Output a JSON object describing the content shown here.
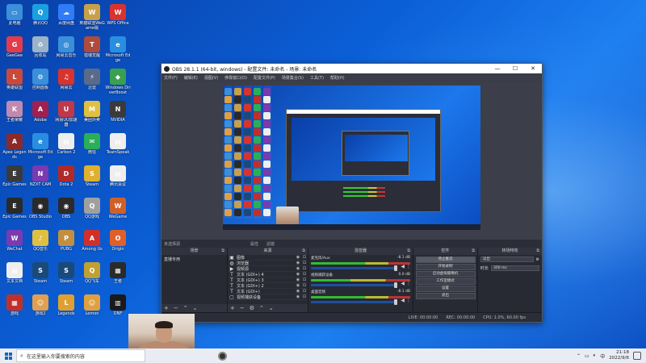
{
  "desktop_icons": [
    {
      "label": "此电脑",
      "color": "#3a8fd8",
      "glyph": "▭"
    },
    {
      "label": "腾讯QQ",
      "color": "#1aa0e0",
      "glyph": "Q"
    },
    {
      "label": "百度网盘",
      "color": "#2f7cf6",
      "glyph": "☁"
    },
    {
      "label": "英雄联盟WeGame版",
      "color": "#c9a04a",
      "glyph": "W"
    },
    {
      "label": "WPS Office",
      "color": "#d9332f",
      "glyph": "W"
    },
    {
      "label": "GeeGee",
      "color": "#e23c4a",
      "glyph": "G"
    },
    {
      "label": "回收站",
      "color": "#9ab3c9",
      "glyph": "♻"
    },
    {
      "label": "网易云音乐",
      "color": "#3a8fd8",
      "glyph": "◎"
    },
    {
      "label": "猎魂觉醒",
      "color": "#b04a3a",
      "glyph": "T"
    },
    {
      "label": "Microsoft Edge",
      "color": "#2a8ee0",
      "glyph": "e"
    },
    {
      "label": "英雄联盟",
      "color": "#c94a3a",
      "glyph": "L"
    },
    {
      "label": "控制面板",
      "color": "#3a8fd8",
      "glyph": "⚙"
    },
    {
      "label": "网易云",
      "color": "#d9332f",
      "glyph": "♫"
    },
    {
      "label": "迅雷",
      "color": "#5a6a8a",
      "glyph": "⚡"
    },
    {
      "label": "Windows DriverBoost",
      "color": "#3aa050",
      "glyph": "◆"
    },
    {
      "label": "王者荣耀",
      "color": "#c08ab0",
      "glyph": "K"
    },
    {
      "label": "Adobe",
      "color": "#a02050",
      "glyph": "A"
    },
    {
      "label": "网易UU加速器",
      "color": "#c0384a",
      "glyph": "U"
    },
    {
      "label": "美团外卖",
      "color": "#e0c040",
      "glyph": "M"
    },
    {
      "label": "NVIDIA",
      "color": "#3a3a3a",
      "glyph": "N"
    },
    {
      "label": "Apex Legends",
      "color": "#8a2a2a",
      "glyph": "A"
    },
    {
      "label": "Microsoft Edge",
      "color": "#2a8ee0",
      "glyph": "e"
    },
    {
      "label": "Carbon 2",
      "color": "#eeeeee",
      "glyph": "▤"
    },
    {
      "label": "微信",
      "color": "#2aae5a",
      "glyph": "✉"
    },
    {
      "label": "TeamSpeak",
      "color": "#eeeeee",
      "glyph": "▤"
    },
    {
      "label": "Epic Games",
      "color": "#3a3a3a",
      "glyph": "E"
    },
    {
      "label": "NZXT CAM",
      "color": "#7a3ab0",
      "glyph": "N"
    },
    {
      "label": "Dota 2",
      "color": "#b02a2a",
      "glyph": "D"
    },
    {
      "label": "Steam",
      "color": "#e0b030",
      "glyph": "S"
    },
    {
      "label": "腾讯会议",
      "color": "#eeeeee",
      "glyph": "▤"
    },
    {
      "label": "Epic Games",
      "color": "#2a2a2a",
      "glyph": "E"
    },
    {
      "label": "OBS Studio",
      "color": "#2a2a2a",
      "glyph": "◉"
    },
    {
      "label": "OBS",
      "color": "#2a2a2a",
      "glyph": "◉"
    },
    {
      "label": "QQ游戏",
      "color": "#a0a0a0",
      "glyph": "Q"
    },
    {
      "label": "WeGame",
      "color": "#d0602a",
      "glyph": "W"
    },
    {
      "label": "WeChat",
      "color": "#7a3ab0",
      "glyph": "W"
    },
    {
      "label": "QQ音乐",
      "color": "#e0c040",
      "glyph": "♪"
    },
    {
      "label": "PUBG",
      "color": "#c09040",
      "glyph": "P"
    },
    {
      "label": "Among Us",
      "color": "#d0302a",
      "glyph": "A"
    },
    {
      "label": "Origin",
      "color": "#e0602a",
      "glyph": "O"
    },
    {
      "label": "文本文档",
      "color": "#eeeeee",
      "glyph": "▤"
    },
    {
      "label": "Steam",
      "color": "#1a4a7a",
      "glyph": "S"
    },
    {
      "label": "Steam",
      "color": "#1a4a7a",
      "glyph": "S"
    },
    {
      "label": "QQ飞车",
      "color": "#c0a030",
      "glyph": "Q"
    },
    {
      "label": "王者",
      "color": "#2a2a2a",
      "glyph": "▦"
    },
    {
      "label": "游戏",
      "color": "#c0302a",
      "glyph": "▦"
    },
    {
      "label": "游戏2",
      "color": "#e0a050",
      "glyph": "☺"
    },
    {
      "label": "Legends",
      "color": "#e0a030",
      "glyph": "L"
    },
    {
      "label": "Lemon",
      "color": "#e0a040",
      "glyph": "☺"
    },
    {
      "label": "DNF",
      "color": "#1a1a1a",
      "glyph": "▥"
    },
    {
      "label": "Wing",
      "color": "#c0302a",
      "glyph": "W"
    },
    {
      "label": "QQ堂",
      "color": "#e0a050",
      "glyph": "☺"
    }
  ],
  "obs": {
    "title": "OBS 28.1.1 (64-bit, windows) - 配置文件: 未命名 - 场景: 未命名",
    "menu": [
      "文件(F)",
      "编辑(E)",
      "视图(V)",
      "停靠窗口(D)",
      "配置文件(P)",
      "场景集合(S)",
      "工具(T)",
      "帮助(H)"
    ],
    "status_strip": {
      "label": "未选择源",
      "props": "属性",
      "filters": "滤镜"
    },
    "docks": {
      "scenes": {
        "title": "场景",
        "items": [
          "直播专用"
        ]
      },
      "sources": {
        "title": "来源",
        "items": [
          {
            "icon": "▣",
            "name": "图像"
          },
          {
            "icon": "◍",
            "name": "浏览器"
          },
          {
            "icon": "▶",
            "name": "视频源"
          },
          {
            "icon": "T",
            "name": "文本 (GDI+) 4"
          },
          {
            "icon": "T",
            "name": "文本 (GDI+) 3"
          },
          {
            "icon": "T",
            "name": "文本 (GDI+) 2"
          },
          {
            "icon": "T",
            "name": "文本 (GDI+)"
          },
          {
            "icon": "▢",
            "name": "视频捕获设备"
          }
        ]
      },
      "mixer": {
        "title": "混音器",
        "channels": [
          {
            "name": "麦克风/Aux",
            "db": "-8.1 dB"
          },
          {
            "name": "视频捕获设备",
            "db": "0.0 dB"
          },
          {
            "name": "桌面音频",
            "db": "-8.1 dB"
          }
        ]
      },
      "controls": {
        "title": "控件",
        "buttons": [
          "停止推流",
          "开始录制",
          "启动虚拟摄像机",
          "工作室模式",
          "设置",
          "退出"
        ]
      },
      "transitions": {
        "title": "转场特效",
        "type": "淡出",
        "duration_label": "时长",
        "duration": "300 ms"
      }
    },
    "status": {
      "live": "LIVE: 00:00:00",
      "rec": "REC: 00:00:00",
      "cpu": "CPU: 1.0%, 60.00 fps"
    }
  },
  "taskbar": {
    "search_placeholder": "在这里输入你要搜索的内容",
    "time": "21:18",
    "date": "2022/9/6"
  }
}
